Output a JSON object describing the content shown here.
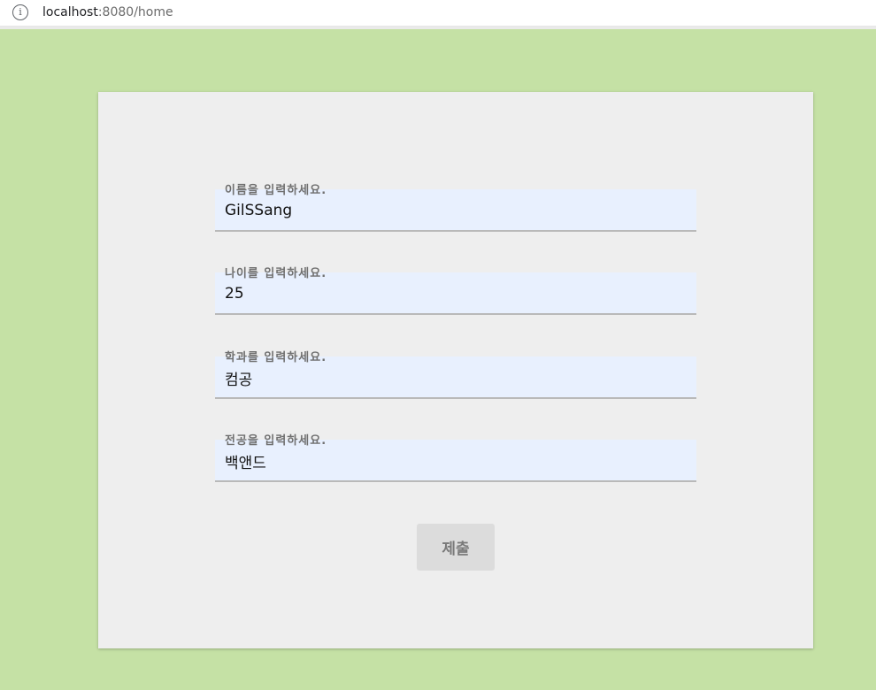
{
  "browser": {
    "url_host": "localhost",
    "url_rest": ":8080/home",
    "info_icon": "info-icon"
  },
  "form": {
    "fields": [
      {
        "label": "이름을 입력하세요.",
        "value": "GilSSang"
      },
      {
        "label": "나이를 입력하세요.",
        "value": "25"
      },
      {
        "label": "학과를 입력하세요.",
        "value": "컴공"
      },
      {
        "label": "전공을 입력하세요.",
        "value": "백앤드"
      }
    ],
    "submit_label": "제출"
  },
  "colors": {
    "page_background": "#c5e1a5",
    "card_background": "#eeeeee",
    "input_background": "#e8f0fe",
    "button_background": "#dcdcdc"
  }
}
